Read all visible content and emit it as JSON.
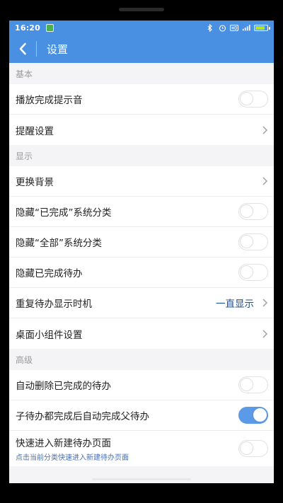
{
  "status_bar": {
    "time": "16:20"
  },
  "header": {
    "title": "设置"
  },
  "sections": {
    "basic": {
      "title": "基本",
      "play_sound": "播放完成提示音",
      "reminder": "提醒设置"
    },
    "display": {
      "title": "显示",
      "background": "更换背景",
      "hide_completed_category": "隐藏“已完成”系统分类",
      "hide_all_category": "隐藏“全部”系统分类",
      "hide_completed_todos": "隐藏已完成待办",
      "repeat_display_timing": "重复待办显示时机",
      "repeat_display_timing_value": "一直显示",
      "widget_settings": "桌面小组件设置"
    },
    "advanced": {
      "title": "高级",
      "auto_delete": "自动删除已完成的待办",
      "auto_complete_parent": "子待办都完成后自动完成父待办",
      "quick_new": "快速进入新建待办页面",
      "quick_new_desc": "点击当前分类快速进入新建待办页面"
    }
  },
  "toggles": {
    "play_sound": false,
    "hide_completed_category": false,
    "hide_all_category": false,
    "hide_completed_todos": false,
    "auto_delete": false,
    "auto_complete_parent": true,
    "quick_new": false
  },
  "colors": {
    "accent": "#4a90e2",
    "toggle_on": "#5a9ae6",
    "value_text": "#1e4e8c"
  },
  "icons": [
    "back-icon",
    "chevron-right-icon",
    "bluetooth-icon",
    "alarm-icon",
    "hd-icon",
    "signal-icon",
    "battery-icon",
    "notification-icon"
  ]
}
